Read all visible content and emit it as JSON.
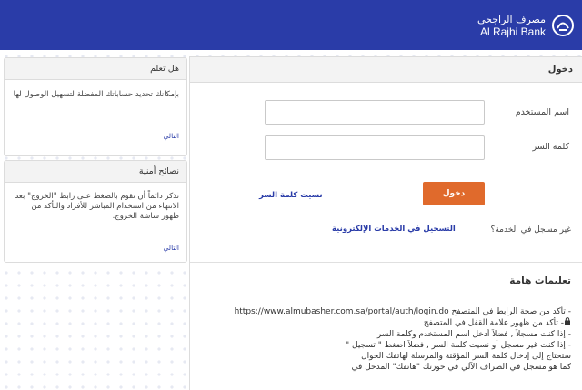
{
  "header": {
    "bank_name_ar": "مصرف الراجحي",
    "bank_name_en": "Al Rajhi Bank",
    "logo_icon": "al-rajhi-logo-icon",
    "color": "#2a3ca8"
  },
  "tips_panel": {
    "title": "هل تعلم",
    "text": "بإمكانك تحديد حساباتك المفضلة لتسهيل الوصول لها",
    "next_label": "التالي"
  },
  "security_panel": {
    "title": "نصائح أمنية",
    "text": "تذكر دائماً أن تقوم بالضغط على رابط \"الخروج\" بعد الانتهاء من استخدام المباشر للأفراد والتأكد من ظهور شاشة الخروج.",
    "next_label": "التالي"
  },
  "login": {
    "title": "دخول",
    "username_label": "اسم المستخدم",
    "username_value": "",
    "password_label": "كلمة السر",
    "password_value": "",
    "login_button": "دخول",
    "login_button_color": "#e06a2c",
    "forgot_password": "نسيت كلمة السر",
    "not_registered": "غير مسجل في الخدمة؟",
    "register_link": "التسجيل في الخدمات الإلكترونية"
  },
  "notes": {
    "title": "تعليمات هامة",
    "lines": [
      "- تأكد من صحة الرابط في المتصفح https://www.almubasher.com.sa/portal/auth/login.do",
      "- تأكد من ظهور علامة القفل في المتصفح",
      "- إذا كنت مسجلاً , فضلاً أدخل اسم المستخدم وكلمة السر",
      "- إذا كنت غير مسجل أو نسيت كلمة السر , فضلاً اضغط \" تسجيل \"",
      "ستحتاج إلى إدخال كلمة السر المؤقتة والمرسلة لهاتفك الجوال",
      "كما هو مسجل في الصراف الآلي في حوزتك \"هاتفك\" المدخل في"
    ]
  }
}
